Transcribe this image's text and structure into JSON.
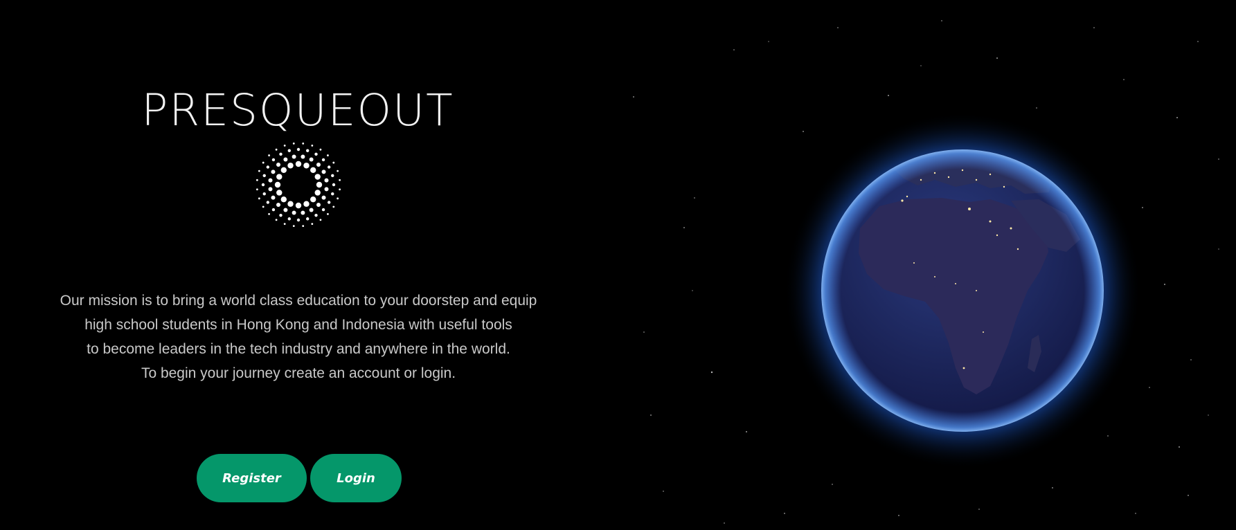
{
  "brand": {
    "name": "PRESQUEOUT",
    "logo_icon": "sunburst-dots-icon"
  },
  "mission": {
    "lines": [
      "Our mission is to bring a world class education to your doorstep and equip",
      "high school students in Hong Kong and Indonesia with useful tools",
      "to become leaders in the tech industry and anywhere in the world.",
      "To begin your journey create an account or login."
    ]
  },
  "actions": {
    "register_label": "Register",
    "login_label": "Login"
  },
  "colors": {
    "background": "#000000",
    "button": "#05976a",
    "globe_glow": "#2f7bff"
  },
  "hero_image": {
    "icon": "earth-globe-icon"
  }
}
